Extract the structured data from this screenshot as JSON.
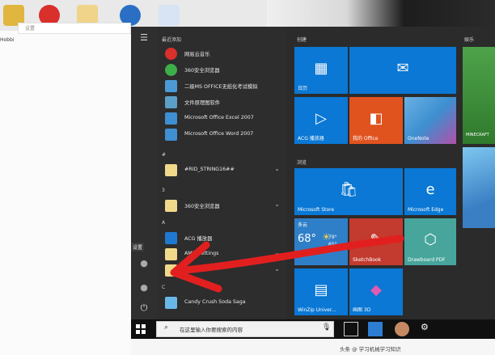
{
  "address_placeholder": "设置",
  "left_label": "Hobbi",
  "start_menu": {
    "recent_header": "最近添加",
    "apps": [
      {
        "label": "网易云音乐",
        "icon": "netease-music-icon"
      },
      {
        "label": "360安全浏览器",
        "icon": "browser-360-icon"
      },
      {
        "label": "二级MS OFFICE无纸化考试模拟",
        "icon": "exam-icon"
      },
      {
        "label": "文件原理图软件",
        "icon": "file-tool-icon"
      },
      {
        "label": "Microsoft Office Excel 2007",
        "icon": "excel-icon"
      },
      {
        "label": "Microsoft Office Word 2007",
        "icon": "word-icon"
      }
    ],
    "sections": [
      {
        "letter": "#"
      },
      {
        "letter": "3"
      },
      {
        "letter": "A"
      },
      {
        "letter": "C"
      }
    ],
    "folder_apps": [
      {
        "label": "#RID_STRING16##",
        "icon": "folder-icon"
      },
      {
        "label": "360安全浏览器",
        "icon": "folder-icon"
      },
      {
        "label": "ACG 播放器",
        "icon": "acg-player-icon"
      },
      {
        "label": "AMD Settings",
        "icon": "folder-icon"
      },
      {
        "label": "",
        "icon": "folder-icon"
      },
      {
        "label": "Candy Crush Soda Saga",
        "icon": "candy-crush-icon"
      }
    ],
    "settings_tooltip": "设置"
  },
  "tile_groups": {
    "create_label": "创建",
    "browse_label": "浏览",
    "play_label": "娱乐"
  },
  "tiles": {
    "calendar": "日历",
    "mail": "",
    "acg": "ACG 播放器",
    "office": "我的 Office",
    "onenote": "OneNote",
    "store": "Microsoft Store",
    "edge": "Microsoft Edge",
    "weather_top": "多云",
    "weather_temp": "68°",
    "weather_hi": "79°",
    "weather_lo": "65°",
    "sketchbook": "SketchBook",
    "drawboard": "Drawboard PDF",
    "winzip": "WinZip Univer...",
    "paint3d": "画图 3D",
    "minecraft": "MINECRAFT"
  },
  "taskbar": {
    "search_placeholder": "在这里输入你要搜索的内容"
  },
  "watermark": "头条 @ 学习机械学习知识"
}
